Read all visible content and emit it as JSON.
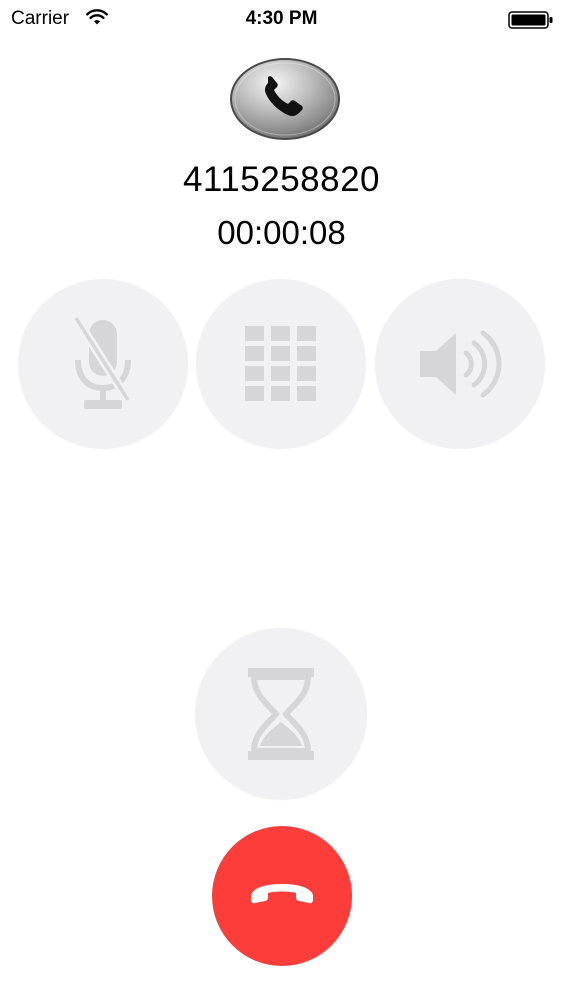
{
  "status_bar": {
    "carrier": "Carrier",
    "time": "4:30 PM",
    "icons": [
      "wifi-icon",
      "battery-icon"
    ]
  },
  "call": {
    "avatar_icon": "phone-handset-icon",
    "number": "4115258820",
    "duration": "00:00:08"
  },
  "controls": {
    "mute_icon": "microphone-muted-icon",
    "keypad_icon": "keypad-grid-icon",
    "speaker_icon": "speaker-icon",
    "hold_icon": "hourglass-icon",
    "end_icon": "hang-up-icon"
  },
  "colors": {
    "end_call": "#fc3d39",
    "control_bg": "#f1f1f3",
    "control_icon": "#d6d6d8"
  }
}
